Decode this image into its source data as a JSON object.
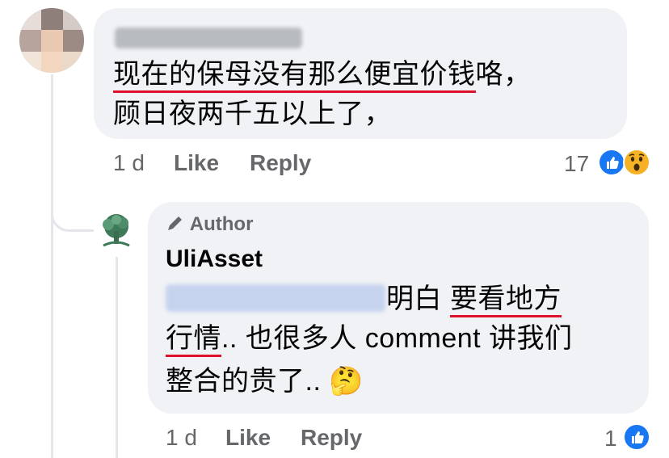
{
  "comment": {
    "line1_part1": "现在的保母没有那么便宜价钱",
    "line1_part2": "咯，",
    "line2": "顾日夜两千五以上了，",
    "time": "1 d",
    "like_label": "Like",
    "reply_label": "Reply",
    "reaction_count": "17",
    "reactions": [
      "like-icon",
      "wow-icon"
    ]
  },
  "reply": {
    "author_badge": "Author",
    "author_name": "UliAsset",
    "line1_text": " 明白 ",
    "line1_ul": "要看地方",
    "line2_ul": "行情",
    "line2_rest": ".. 也很多人 comment 讲我们",
    "line3": "整合的贵了.. ",
    "emoji": "🤔",
    "time": "1 d",
    "like_label": "Like",
    "reply_label": "Reply",
    "reaction_count": "1",
    "reactions": [
      "like-icon"
    ]
  },
  "colors": {
    "bubble": "#f0f2f5",
    "underline": "#e0112b",
    "like_blue": "#1877f2",
    "meta": "#65676b"
  }
}
